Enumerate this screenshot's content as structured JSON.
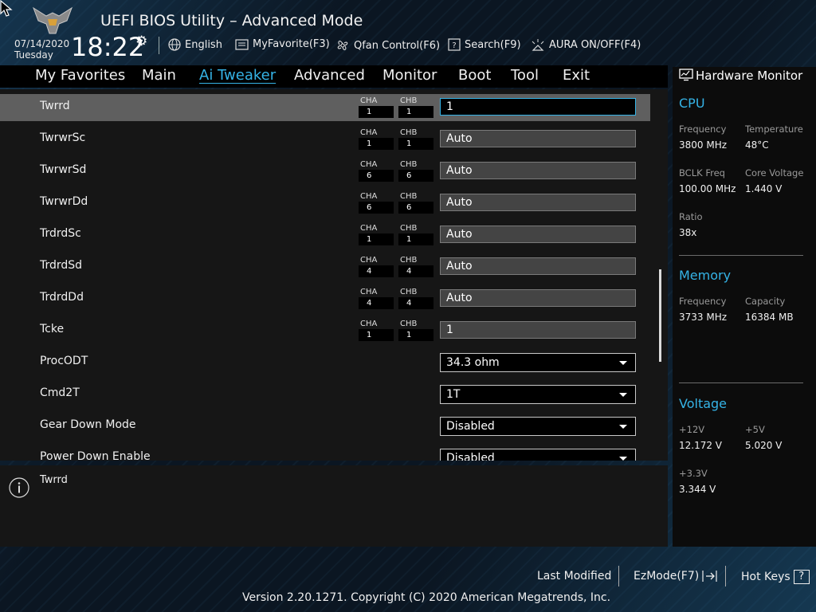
{
  "header": {
    "title": "UEFI BIOS Utility – Advanced Mode",
    "date": "07/14/2020",
    "weekday": "Tuesday",
    "time": "18:22",
    "toolbar": {
      "language": "English",
      "favorite": "MyFavorite(F3)",
      "qfan": "Qfan Control(F6)",
      "search": "Search(F9)",
      "aura": "AURA ON/OFF(F4)"
    }
  },
  "menu": {
    "items": [
      "My Favorites",
      "Main",
      "Ai Tweaker",
      "Advanced",
      "Monitor",
      "Boot",
      "Tool",
      "Exit"
    ],
    "active": "Ai Tweaker"
  },
  "settings": {
    "ch_a": "CHA",
    "ch_b": "CHB",
    "rows": [
      {
        "label": "Twrrd",
        "cha": "1",
        "chb": "1",
        "value": "1"
      },
      {
        "label": "TwrwrSc",
        "cha": "1",
        "chb": "1",
        "value": "Auto"
      },
      {
        "label": "TwrwrSd",
        "cha": "6",
        "chb": "6",
        "value": "Auto"
      },
      {
        "label": "TwrwrDd",
        "cha": "6",
        "chb": "6",
        "value": "Auto"
      },
      {
        "label": "TrdrdSc",
        "cha": "1",
        "chb": "1",
        "value": "Auto"
      },
      {
        "label": "TrdrdSd",
        "cha": "4",
        "chb": "4",
        "value": "Auto"
      },
      {
        "label": "TrdrdDd",
        "cha": "4",
        "chb": "4",
        "value": "Auto"
      },
      {
        "label": "Tcke",
        "cha": "1",
        "chb": "1",
        "value": "1"
      },
      {
        "label": "ProcODT",
        "value": "34.3 ohm"
      },
      {
        "label": "Cmd2T",
        "value": "1T"
      },
      {
        "label": "Gear Down Mode",
        "value": "Disabled"
      },
      {
        "label": "Power Down Enable",
        "value": "Disabled"
      }
    ]
  },
  "help": {
    "text": "Twrrd"
  },
  "hardware_monitor": {
    "title": "Hardware Monitor",
    "cpu": {
      "heading": "CPU",
      "frequency_label": "Frequency",
      "frequency": "3800 MHz",
      "temperature_label": "Temperature",
      "temperature": "48°C",
      "bclk_label": "BCLK Freq",
      "bclk": "100.00 MHz",
      "core_voltage_label": "Core Voltage",
      "core_voltage": "1.440 V",
      "ratio_label": "Ratio",
      "ratio": "38x"
    },
    "memory": {
      "heading": "Memory",
      "frequency_label": "Frequency",
      "frequency": "3733 MHz",
      "capacity_label": "Capacity",
      "capacity": "16384 MB"
    },
    "voltage": {
      "heading": "Voltage",
      "v12_label": "+12V",
      "v12": "12.172 V",
      "v5_label": "+5V",
      "v5": "5.020 V",
      "v33_label": "+3.3V",
      "v33": "3.344 V"
    }
  },
  "footer": {
    "last_modified": "Last Modified",
    "ezmode": "EzMode(F7)",
    "hotkeys": "Hot Keys",
    "hotkeys_glyph": "?",
    "copyright": "Version 2.20.1271. Copyright (C) 2020 American Megatrends, Inc."
  },
  "colors": {
    "accent": "#35b3e6",
    "selected_row": "#5f5f5f",
    "panel": "#161616"
  }
}
